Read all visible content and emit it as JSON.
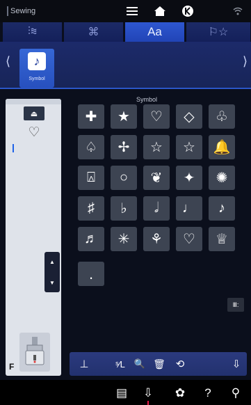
{
  "topbar": {
    "title": "Sewing",
    "icons": [
      "menu-icon",
      "home-icon",
      "back-icon",
      "wifi-icon"
    ]
  },
  "tabs": [
    {
      "name": "stitch-tab",
      "label": "⫶≋",
      "icon": "stitch-icon"
    },
    {
      "name": "pattern-tab",
      "label": "⌘",
      "icon": "decorative-icon"
    },
    {
      "name": "alphabet-tab",
      "label": "Aa",
      "icon": "alphabet-icon",
      "active": true
    },
    {
      "name": "favorites-tab",
      "label": "⚐☆",
      "icon": "star-icon"
    }
  ],
  "category": {
    "label": "Symbol",
    "icon": "music-note-icon",
    "left_arrow": "⟨",
    "right_arrow": "⟩"
  },
  "grid": {
    "label": "Symbol",
    "rows": [
      [
        "✚",
        "★",
        "♡",
        "◇",
        "♧"
      ],
      [
        "♤",
        "✢",
        "☆",
        "☆",
        "🔔"
      ],
      [
        "⍓",
        "○",
        "❦",
        "✦",
        "✺"
      ],
      [
        "♯",
        "♭",
        "𝅗𝅥",
        "♩",
        "♪"
      ],
      [
        "♬",
        "✳",
        "⚘",
        "♡",
        "♕"
      ],
      [
        "."
      ]
    ]
  },
  "left_panel": {
    "sequence_icon": "⏏",
    "selected_symbol": "♡",
    "presser_foot": "F",
    "scroll_up": "▲",
    "scroll_down": "▼"
  },
  "right_button": "Ⅲ:",
  "toolbar": {
    "items": [
      "⊥",
      "ˢ⁄L",
      "🔍",
      "🗑",
      "⟲",
      "⇩"
    ]
  },
  "bottomnav": {
    "items": [
      "▤",
      "⇩",
      "✿",
      "?",
      "⚲"
    ]
  },
  "colors": {
    "accent": "#2a56c8",
    "tab_active": "#2e57d0",
    "tab_inactive": "#1c2a66",
    "cell": "#3d4452",
    "marker": "#e81848"
  }
}
